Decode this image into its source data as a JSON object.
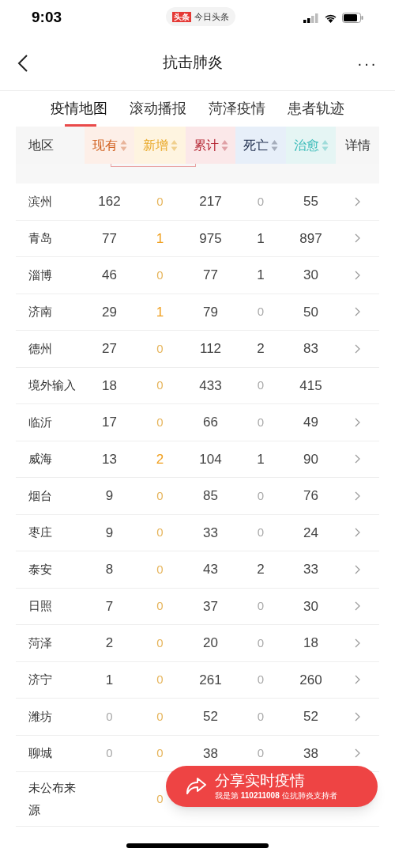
{
  "status_bar": {
    "time": "9:03",
    "app_badge": "头条",
    "app_name": "今日头条"
  },
  "nav": {
    "title": "抗击肺炎",
    "more": "···"
  },
  "tabs": [
    {
      "label": "疫情地图",
      "selected": true
    },
    {
      "label": "滚动播报",
      "selected": false
    },
    {
      "label": "菏泽疫情",
      "selected": false
    },
    {
      "label": "患者轨迹",
      "selected": false
    }
  ],
  "table": {
    "columns": [
      {
        "label": "地区",
        "kind": "region"
      },
      {
        "label": "现有",
        "kind": "current"
      },
      {
        "label": "新增",
        "kind": "new"
      },
      {
        "label": "累计",
        "kind": "total"
      },
      {
        "label": "死亡",
        "kind": "death"
      },
      {
        "label": "治愈",
        "kind": "cured"
      },
      {
        "label": "详情",
        "kind": "detail"
      }
    ],
    "rows": [
      {
        "region": "滨州",
        "cells": {
          "current": {
            "text": "162",
            "muted": false
          },
          "new": {
            "text": "0",
            "muted": true
          },
          "total": {
            "text": "217",
            "muted": false
          },
          "death": {
            "text": "0",
            "muted": true
          },
          "cured": {
            "text": "55",
            "muted": false
          }
        },
        "detail": true
      },
      {
        "region": "青岛",
        "cells": {
          "current": {
            "text": "77",
            "muted": false
          },
          "new": {
            "text": "1",
            "muted": false
          },
          "total": {
            "text": "975",
            "muted": false
          },
          "death": {
            "text": "1",
            "muted": false
          },
          "cured": {
            "text": "897",
            "muted": false
          }
        },
        "detail": true
      },
      {
        "region": "淄博",
        "cells": {
          "current": {
            "text": "46",
            "muted": false
          },
          "new": {
            "text": "0",
            "muted": true
          },
          "total": {
            "text": "77",
            "muted": false
          },
          "death": {
            "text": "1",
            "muted": false
          },
          "cured": {
            "text": "30",
            "muted": false
          }
        },
        "detail": true
      },
      {
        "region": "济南",
        "cells": {
          "current": {
            "text": "29",
            "muted": false
          },
          "new": {
            "text": "1",
            "muted": false
          },
          "total": {
            "text": "79",
            "muted": false
          },
          "death": {
            "text": "0",
            "muted": true
          },
          "cured": {
            "text": "50",
            "muted": false
          }
        },
        "detail": true
      },
      {
        "region": "德州",
        "cells": {
          "current": {
            "text": "27",
            "muted": false
          },
          "new": {
            "text": "0",
            "muted": true
          },
          "total": {
            "text": "112",
            "muted": false
          },
          "death": {
            "text": "2",
            "muted": false
          },
          "cured": {
            "text": "83",
            "muted": false
          }
        },
        "detail": true
      },
      {
        "region": "境外输入",
        "cells": {
          "current": {
            "text": "18",
            "muted": false
          },
          "new": {
            "text": "0",
            "muted": true
          },
          "total": {
            "text": "433",
            "muted": false
          },
          "death": {
            "text": "0",
            "muted": true
          },
          "cured": {
            "text": "415",
            "muted": false
          }
        },
        "detail": false
      },
      {
        "region": "临沂",
        "cells": {
          "current": {
            "text": "17",
            "muted": false
          },
          "new": {
            "text": "0",
            "muted": true
          },
          "total": {
            "text": "66",
            "muted": false
          },
          "death": {
            "text": "0",
            "muted": true
          },
          "cured": {
            "text": "49",
            "muted": false
          }
        },
        "detail": true
      },
      {
        "region": "威海",
        "cells": {
          "current": {
            "text": "13",
            "muted": false
          },
          "new": {
            "text": "2",
            "muted": false
          },
          "total": {
            "text": "104",
            "muted": false
          },
          "death": {
            "text": "1",
            "muted": false
          },
          "cured": {
            "text": "90",
            "muted": false
          }
        },
        "detail": true
      },
      {
        "region": "烟台",
        "cells": {
          "current": {
            "text": "9",
            "muted": false
          },
          "new": {
            "text": "0",
            "muted": true
          },
          "total": {
            "text": "85",
            "muted": false
          },
          "death": {
            "text": "0",
            "muted": true
          },
          "cured": {
            "text": "76",
            "muted": false
          }
        },
        "detail": true
      },
      {
        "region": "枣庄",
        "cells": {
          "current": {
            "text": "9",
            "muted": false
          },
          "new": {
            "text": "0",
            "muted": true
          },
          "total": {
            "text": "33",
            "muted": false
          },
          "death": {
            "text": "0",
            "muted": true
          },
          "cured": {
            "text": "24",
            "muted": false
          }
        },
        "detail": true
      },
      {
        "region": "泰安",
        "cells": {
          "current": {
            "text": "8",
            "muted": false
          },
          "new": {
            "text": "0",
            "muted": true
          },
          "total": {
            "text": "43",
            "muted": false
          },
          "death": {
            "text": "2",
            "muted": false
          },
          "cured": {
            "text": "33",
            "muted": false
          }
        },
        "detail": true
      },
      {
        "region": "日照",
        "cells": {
          "current": {
            "text": "7",
            "muted": false
          },
          "new": {
            "text": "0",
            "muted": true
          },
          "total": {
            "text": "37",
            "muted": false
          },
          "death": {
            "text": "0",
            "muted": true
          },
          "cured": {
            "text": "30",
            "muted": false
          }
        },
        "detail": true
      },
      {
        "region": "菏泽",
        "cells": {
          "current": {
            "text": "2",
            "muted": false
          },
          "new": {
            "text": "0",
            "muted": true
          },
          "total": {
            "text": "20",
            "muted": false
          },
          "death": {
            "text": "0",
            "muted": true
          },
          "cured": {
            "text": "18",
            "muted": false
          }
        },
        "detail": true
      },
      {
        "region": "济宁",
        "cells": {
          "current": {
            "text": "1",
            "muted": false
          },
          "new": {
            "text": "0",
            "muted": true
          },
          "total": {
            "text": "261",
            "muted": false
          },
          "death": {
            "text": "0",
            "muted": true
          },
          "cured": {
            "text": "260",
            "muted": false
          }
        },
        "detail": true
      },
      {
        "region": "潍坊",
        "cells": {
          "current": {
            "text": "0",
            "muted": true
          },
          "new": {
            "text": "0",
            "muted": true
          },
          "total": {
            "text": "52",
            "muted": false
          },
          "death": {
            "text": "0",
            "muted": true
          },
          "cured": {
            "text": "52",
            "muted": false
          }
        },
        "detail": true
      },
      {
        "region": "聊城",
        "cells": {
          "current": {
            "text": "0",
            "muted": true
          },
          "new": {
            "text": "0",
            "muted": true
          },
          "total": {
            "text": "38",
            "muted": false
          },
          "death": {
            "text": "0",
            "muted": true
          },
          "cured": {
            "text": "38",
            "muted": false
          }
        },
        "detail": true
      },
      {
        "region": "未公布来源",
        "cells": {
          "new": {
            "text": "0",
            "muted": true
          }
        },
        "detail": false
      }
    ]
  },
  "share_button": {
    "title": "分享实时疫情",
    "subtitle": "我是第 **110211008** 位抗肺炎支持者"
  }
}
